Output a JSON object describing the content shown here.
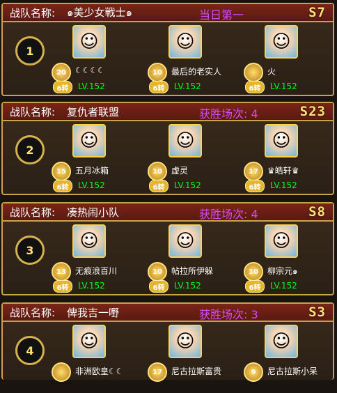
{
  "colors": {
    "border": "#c9a24a",
    "header": "#7a2418",
    "status": "#d94aff",
    "server": "#ffe27a",
    "level": "#00ff1e"
  },
  "teams": [
    {
      "label": "战队名称:",
      "name": "๑美少女戦士๑",
      "status": "当日第一",
      "server": "S7",
      "rank": "1",
      "members": [
        {
          "name": "☾☾☾☾",
          "medal": "20",
          "turn": "6转",
          "level": "LV.152"
        },
        {
          "name": "最后的老实人",
          "medal": "10",
          "turn": "6转",
          "level": "LV.152"
        },
        {
          "name": "火",
          "medal": "",
          "turn": "6转",
          "level": "LV.152"
        }
      ]
    },
    {
      "label": "战队名称:",
      "name": "复仇者联盟",
      "status": "获胜场次: 4",
      "server": "S23",
      "rank": "2",
      "members": [
        {
          "name": "五月冰箱",
          "medal": "15",
          "turn": "6转",
          "level": "LV.152"
        },
        {
          "name": "虚灵",
          "medal": "10",
          "turn": "6转",
          "level": "LV.152"
        },
        {
          "name": "♛皓轩♛",
          "medal": "17",
          "turn": "6转",
          "level": "LV.152"
        }
      ]
    },
    {
      "label": "战队名称:",
      "name": "凑热闹小队",
      "status": "获胜场次: 4",
      "server": "S8",
      "rank": "3",
      "members": [
        {
          "name": "无痕浪百川",
          "medal": "13",
          "turn": "6转",
          "level": "LV.152"
        },
        {
          "name": "帖拉所伊躲",
          "medal": "10",
          "turn": "6转",
          "level": "LV.152"
        },
        {
          "name": "柳宗元๑",
          "medal": "10",
          "turn": "6转",
          "level": "LV.152"
        }
      ]
    },
    {
      "label": "战队名称:",
      "name": "俾我吉一嘢",
      "status": "获胜场次: 3",
      "server": "S3",
      "rank": "4",
      "members": [
        {
          "name": "非洲欧皇☾☾",
          "medal": "",
          "turn": "",
          "level": ""
        },
        {
          "name": "尼古拉斯富贵",
          "medal": "17",
          "turn": "",
          "level": ""
        },
        {
          "name": "尼古拉斯小呆",
          "medal": "9",
          "turn": "",
          "level": ""
        }
      ]
    }
  ]
}
